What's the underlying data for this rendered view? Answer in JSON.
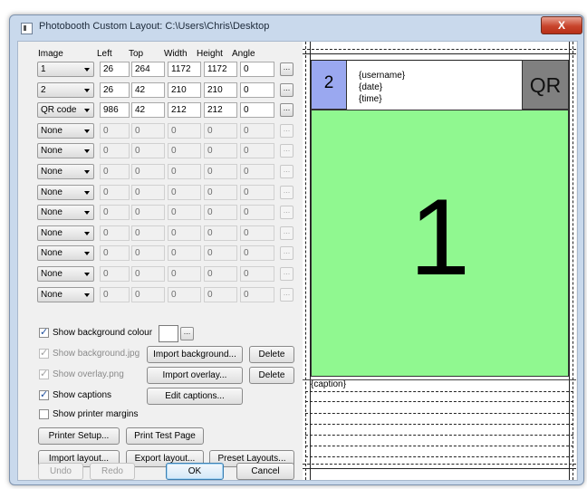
{
  "window": {
    "title": "Photobooth Custom Layout: C:\\Users\\Chris\\Desktop",
    "close_glyph": "X"
  },
  "columns": {
    "image": "Image",
    "left": "Left",
    "top": "Top",
    "width": "Width",
    "height": "Height",
    "angle": "Angle"
  },
  "rows": [
    {
      "image": "1",
      "left": "26",
      "top": "264",
      "width": "1172",
      "height": "1172",
      "angle": "0",
      "enabled": true
    },
    {
      "image": "2",
      "left": "26",
      "top": "42",
      "width": "210",
      "height": "210",
      "angle": "0",
      "enabled": true
    },
    {
      "image": "QR code",
      "left": "986",
      "top": "42",
      "width": "212",
      "height": "212",
      "angle": "0",
      "enabled": true
    },
    {
      "image": "None",
      "left": "0",
      "top": "0",
      "width": "0",
      "height": "0",
      "angle": "0",
      "enabled": false
    },
    {
      "image": "None",
      "left": "0",
      "top": "0",
      "width": "0",
      "height": "0",
      "angle": "0",
      "enabled": false
    },
    {
      "image": "None",
      "left": "0",
      "top": "0",
      "width": "0",
      "height": "0",
      "angle": "0",
      "enabled": false
    },
    {
      "image": "None",
      "left": "0",
      "top": "0",
      "width": "0",
      "height": "0",
      "angle": "0",
      "enabled": false
    },
    {
      "image": "None",
      "left": "0",
      "top": "0",
      "width": "0",
      "height": "0",
      "angle": "0",
      "enabled": false
    },
    {
      "image": "None",
      "left": "0",
      "top": "0",
      "width": "0",
      "height": "0",
      "angle": "0",
      "enabled": false
    },
    {
      "image": "None",
      "left": "0",
      "top": "0",
      "width": "0",
      "height": "0",
      "angle": "0",
      "enabled": false
    },
    {
      "image": "None",
      "left": "0",
      "top": "0",
      "width": "0",
      "height": "0",
      "angle": "0",
      "enabled": false
    },
    {
      "image": "None",
      "left": "0",
      "top": "0",
      "width": "0",
      "height": "0",
      "angle": "0",
      "enabled": false
    }
  ],
  "ellipsis": "...",
  "options": {
    "show_bg_colour": "Show background colour",
    "show_bg_jpg": "Show background.jpg",
    "show_overlay": "Show overlay.png",
    "show_captions": "Show captions",
    "show_margins": "Show printer margins"
  },
  "buttons": {
    "import_background": "Import background...",
    "delete": "Delete",
    "import_overlay": "Import overlay...",
    "edit_captions": "Edit captions...",
    "printer_setup": "Printer Setup...",
    "print_test": "Print Test Page",
    "import_layout": "Import layout...",
    "export_layout": "Export layout...",
    "preset_layouts": "Preset Layouts...",
    "undo": "Undo",
    "redo": "Redo",
    "ok": "OK",
    "cancel": "Cancel"
  },
  "preview": {
    "small_image_label": "2",
    "caption_username": "{username}",
    "caption_date": "{date}",
    "caption_time": "{time}",
    "qr_label": "QR",
    "main_image_label": "1",
    "caption_label": "{caption}",
    "colors": {
      "small_image": "#9aa8f0",
      "qr": "#808080",
      "main": "#90f890"
    }
  }
}
